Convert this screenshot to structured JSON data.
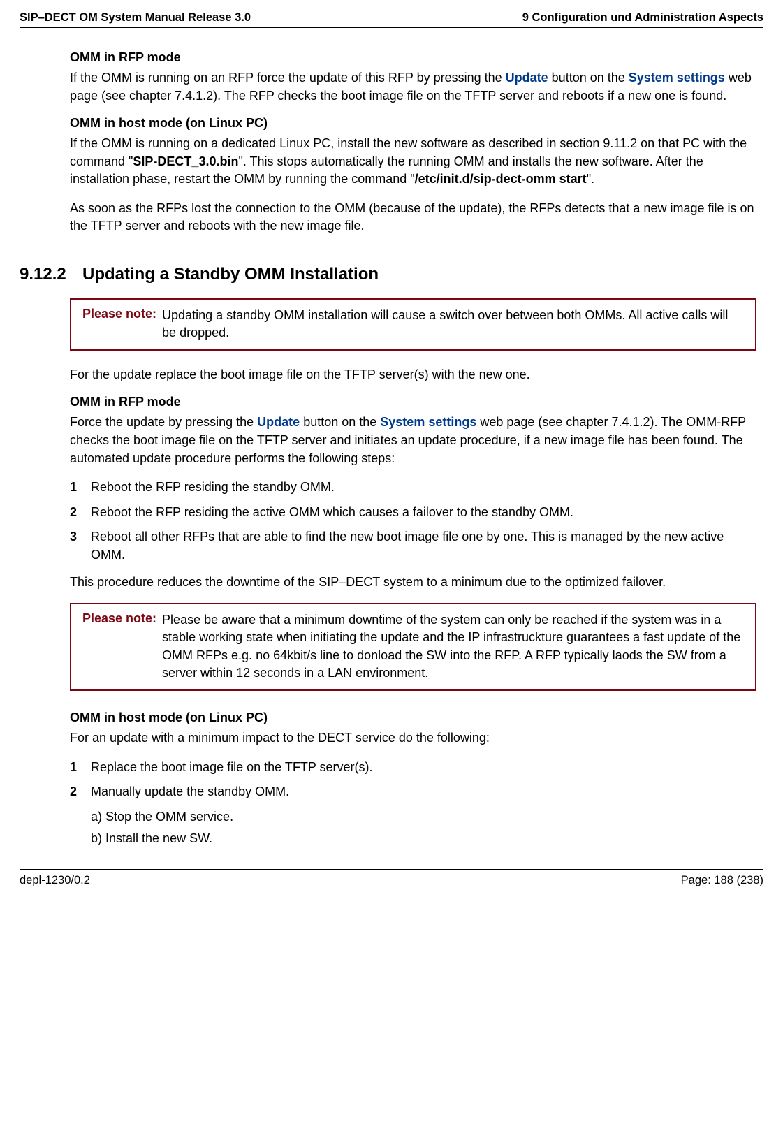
{
  "header": {
    "left": "SIP–DECT OM System Manual Release 3.0",
    "right": "9 Configuration und Administration Aspects"
  },
  "section_rfp": {
    "heading": "OMM in RFP mode",
    "p1_part1": "If the OMM is running on an RFP force the update of this RFP by pressing the ",
    "p1_link1": "Update",
    "p1_part2": " button on the ",
    "p1_link2": "System settings",
    "p1_part3": " web page (see chapter 7.4.1.2). The RFP checks the boot image file on the TFTP server and reboots if a new one is found."
  },
  "section_host": {
    "heading": "OMM in host mode (on Linux PC)",
    "p1_part1": "If the OMM is running on a dedicated Linux PC, install the new software as described in section 9.11.2 on that PC with the command \"",
    "p1_bold1": "SIP-DECT_3.0.bin",
    "p1_part2": "\". This stops automatically the running OMM and installs the new software. After the installation phase, restart the OMM by running the command \"",
    "p1_bold2": "/etc/init.d/sip-dect-omm start",
    "p1_part3": "\".",
    "p2": "As soon as the RFPs lost the connection to the OMM (because of the update), the RFPs detects that a new image file is on the TFTP server and reboots with the new image file."
  },
  "section_9_12_2": {
    "number": "9.12.2",
    "title": "Updating a Standby OMM Installation",
    "note1_label": "Please note:",
    "note1_text": "Updating a standby OMM installation will cause a switch over between both OMMs. All active calls will be dropped.",
    "p1": "For the update replace the boot image file on the TFTP server(s) with the new one.",
    "rfp_heading": "OMM in RFP mode",
    "rfp_p1_part1": "Force the update by pressing the ",
    "rfp_p1_link1": "Update",
    "rfp_p1_part2": " button on the ",
    "rfp_p1_link2": "System settings",
    "rfp_p1_part3": " web page (see chapter 7.4.1.2). The OMM-RFP checks the boot image file on the TFTP server and initiates an update procedure, if a new image file has been found. The automated update procedure performs the following steps:",
    "list1": {
      "item1_num": "1",
      "item1": "Reboot the RFP residing the standby OMM.",
      "item2_num": "2",
      "item2": "Reboot the RFP residing the active OMM which causes a failover to the standby OMM.",
      "item3_num": "3",
      "item3": "Reboot all other RFPs that are able to find the new boot image file one by one. This is managed by the new active OMM."
    },
    "p2": "This procedure reduces the downtime of the SIP–DECT system to a minimum due to the optimized failover.",
    "note2_label": "Please note:",
    "note2_text": "Please be aware that a minimum downtime of the system can only be reached if the system was in a stable working state when initiating the update and the IP infrastruckture guarantees a fast update of the OMM RFPs e.g. no 64kbit/s line to donload the SW into the RFP. A RFP typically laods the SW from a server within 12 seconds in a LAN environment.",
    "host_heading": "OMM in host mode (on Linux PC)",
    "host_p1": "For an update with a minimum impact to the DECT service do the following:",
    "list2": {
      "item1_num": "1",
      "item1": "Replace the boot image file on the TFTP server(s).",
      "item2_num": "2",
      "item2": "Manually update the standby OMM.",
      "sub_a": "a) Stop the OMM service.",
      "sub_b": "b) Install the new SW."
    }
  },
  "footer": {
    "left": "depl-1230/0.2",
    "right": "Page: 188 (238)"
  }
}
